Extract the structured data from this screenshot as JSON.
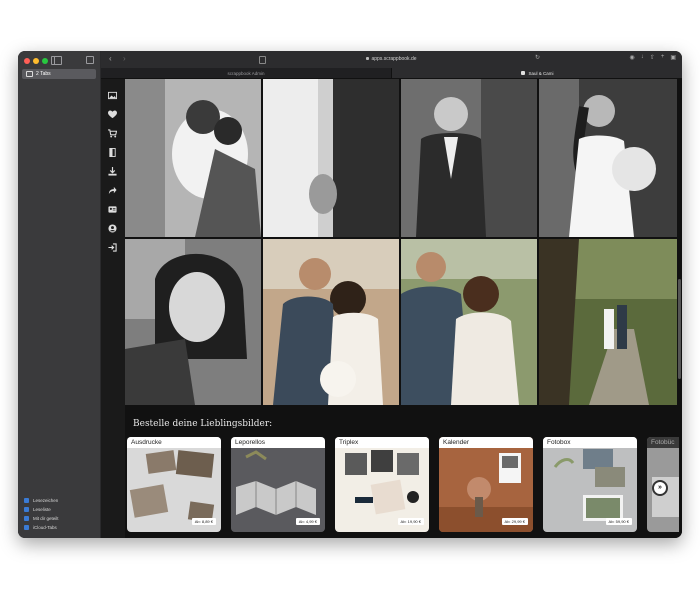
{
  "sidebar": {
    "tab_group": "2 Tabs",
    "links": [
      {
        "label": "Lesezeichen",
        "color": "#3a7bd5"
      },
      {
        "label": "Leseliste",
        "color": "#3a7bd5"
      },
      {
        "label": "Mit dir geteilt",
        "color": "#3a7bd5"
      },
      {
        "label": "iCloud-Tabs",
        "color": "#3a7bd5"
      }
    ]
  },
  "toolbar": {
    "url": "apps.scrappbook.de"
  },
  "tabs": [
    {
      "label": "scrappbook Admin"
    },
    {
      "label": "Saul & Cami"
    }
  ],
  "content": {
    "order_title": "Bestelle deine Lieblingsbilder:",
    "products": [
      {
        "name": "Ausdrucke",
        "price": "Ab: 8,89 €"
      },
      {
        "name": "Leporellos",
        "price": "Ab: 4,99 €"
      },
      {
        "name": "Triplex",
        "price": "Ab: 19,90 €"
      },
      {
        "name": "Kalender",
        "price": "Ab: 29,99 €"
      },
      {
        "name": "Fotobox",
        "price": "Ab: 59,90 €"
      },
      {
        "name": "Fotobüc",
        "price": ""
      }
    ]
  },
  "colors": {
    "traffic_red": "#ff5f57",
    "traffic_yellow": "#febc2e",
    "traffic_green": "#28c840"
  }
}
